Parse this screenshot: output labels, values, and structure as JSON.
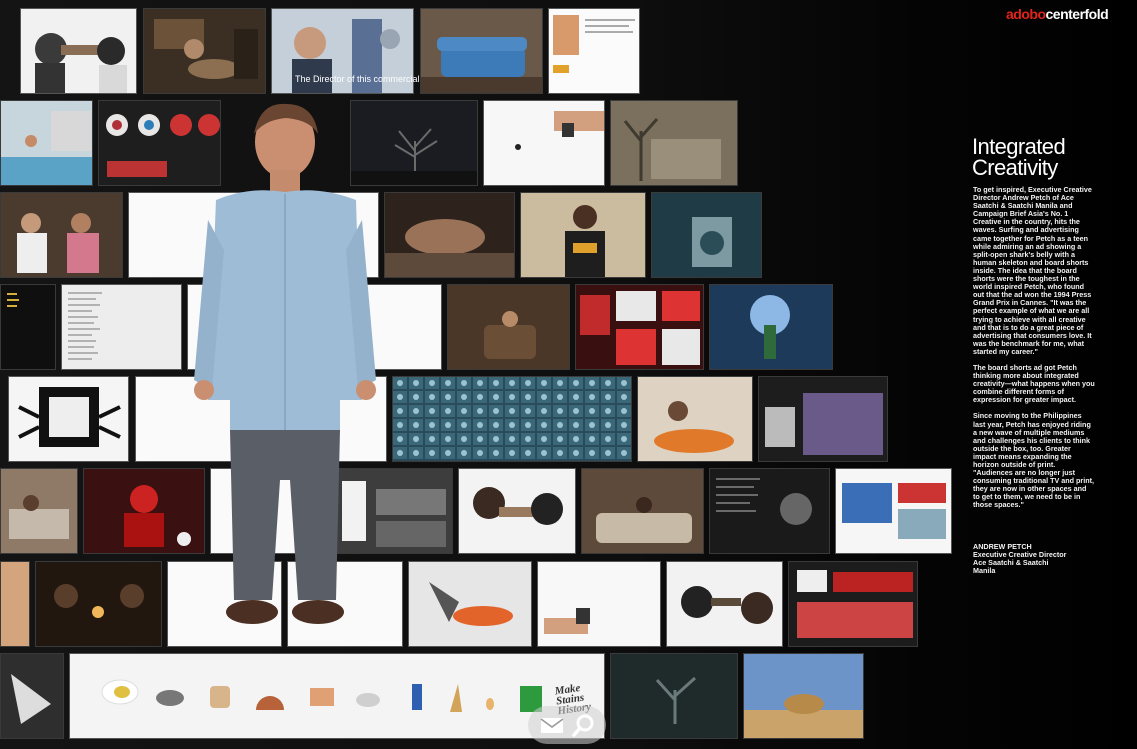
{
  "header": {
    "brand_part1": "adobo",
    "brand_part2": "centerfold"
  },
  "article": {
    "title_line1": "Integrated",
    "title_line2": "Creativity",
    "paragraphs": [
      "To get inspired, Executive Creative Director Andrew Petch of Ace Saatchi & Saatchi Manila and Campaign Brief Asia's No. 1 Creative in the country, hits the waves. Surfing and advertising came together for Petch as a teen while admiring an ad showing a split-open shark's belly with a human skeleton and board shorts inside. The idea that the board shorts were the toughest in the world inspired Petch, who found out that the ad won the 1994 Press Grand Prix in Cannes. \"It was the perfect example of what we are all trying to achieve with all creative and that is to do a great piece of advertising that consumers love. It was the benchmark for me, what started my career.\"",
      "The board shorts ad got Petch thinking more about integrated creativity—what happens when you combine different forms of expression for greater impact.",
      "Since moving to the Philippines last year, Petch has enjoyed riding a new wave of multiple mediums and challenges his clients to think outside the box, too. Greater impact means expanding the horizon outside of print. \"Audiences are no longer just consuming traditional TV and print, they are now in other spaces and to get to them, we need to be in those spaces.\""
    ],
    "credit_name": "ANDREW PETCH",
    "credit_title1": "Executive Creative Director",
    "credit_title2": "Ace Saatchi & Saatchi",
    "credit_title3": "Manila"
  },
  "gallery": {
    "caption_director": "The Director of this commercial",
    "strip_text": "Make Stains History"
  },
  "toolbar": {
    "mail_icon": "envelope-icon",
    "search_icon": "magnifier-icon"
  }
}
